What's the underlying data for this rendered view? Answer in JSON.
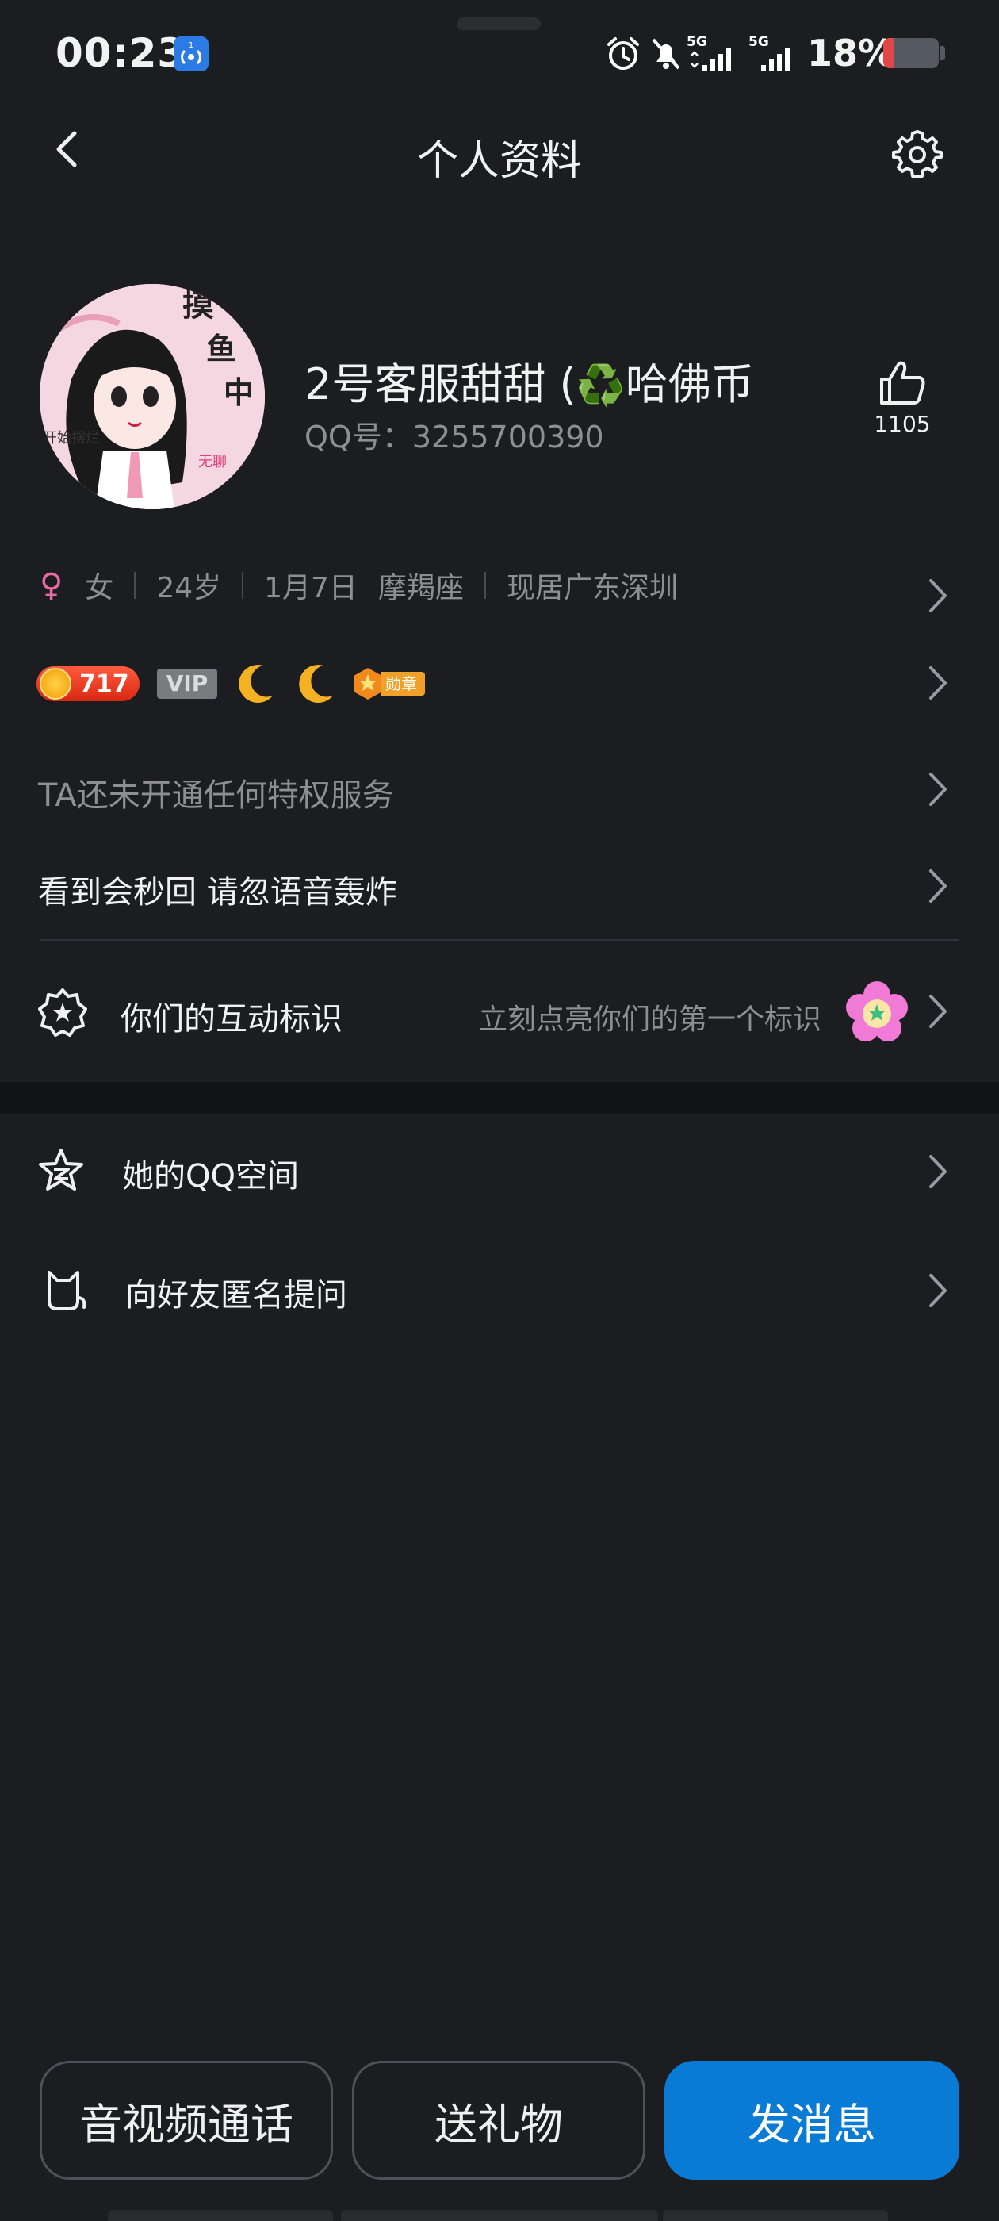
{
  "status_bar": {
    "time": "00:23",
    "battery": "18%",
    "signal_1": "5G",
    "signal_2": "5G"
  },
  "header": {
    "title": "个人资料"
  },
  "profile": {
    "nickname_pre": "2号客服甜甜 (",
    "nickname_emoji": "♻️",
    "nickname_post": "哈佛币",
    "qq_label": "QQ号：",
    "qq_number": "3255700390",
    "likes": "1105"
  },
  "info": {
    "gender": "女",
    "age": "24岁",
    "birthday": "1月7日",
    "zodiac": "摩羯座",
    "location": "现居广东深圳"
  },
  "badges": {
    "level": "717",
    "vip": "VIP",
    "medal": "勋章"
  },
  "rows": {
    "privilege": "TA还未开通任何特权服务",
    "signature": "看到会秒回 请忽语音轰炸",
    "interaction_label": "你们的互动标识",
    "interaction_hint": "立刻点亮你们的第一个标识",
    "qzone": "她的QQ空间",
    "anon_question": "向好友匿名提问"
  },
  "bottom": {
    "call": "音视频通话",
    "gift": "送礼物",
    "message": "发消息"
  },
  "colors": {
    "background": "#1c1d20",
    "primary_button": "#0a7bd4",
    "secondary_text": "#8e8e93"
  }
}
